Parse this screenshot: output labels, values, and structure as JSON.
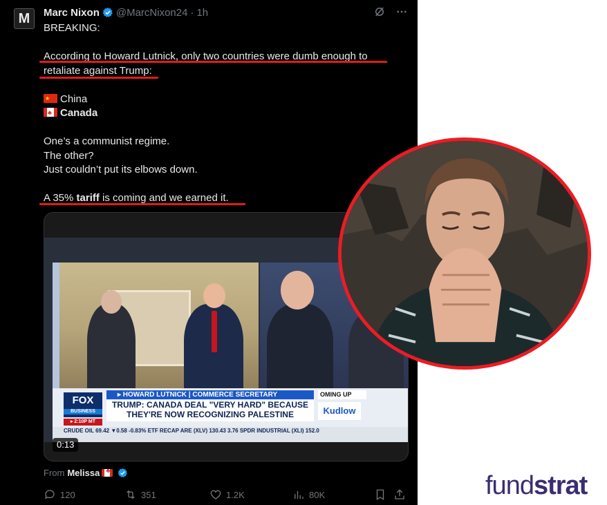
{
  "tweet": {
    "avatar_letter": "M",
    "display_name": "Marc Nixon",
    "handle": "@MarcNixon24",
    "separator": "·",
    "age": "1h",
    "lines": {
      "l1": "BREAKING:",
      "l2": "According to Howard Lutnick, only two countries were dumb enough to",
      "l3": "retaliate against Trump:",
      "l4": "China",
      "l5": "Canada",
      "l6": "One’s a communist regime.",
      "l7": "The other?",
      "l8": "Just couldn’t put its elbows down.",
      "l9_a": "A 35% ",
      "l9_b": "tariff",
      "l9_c": " is coming and we earned it."
    },
    "video": {
      "network_logo": "FOX",
      "network_sub": "BUSINESS",
      "time_badge": "▸ 2:10P MT",
      "name_bar": "▸ HOWARD LUTNICK | COMMERCE SECRETARY",
      "headline": "TRUMP: CANADA DEAL \"VERY HARD\" BECAUSE THEY'RE NOW RECOGNIZING PALESTINE",
      "coming_up": "OMING UP",
      "show": "Kudlow",
      "ticker": "CRUDE OIL 69.42 ▼0.58 -0.83%   ETF RECAP  ARE (XLV) 130.43  3.76   SPDR INDUSTRIAL (XLI) 152.0",
      "elapsed": "0:13"
    },
    "from_label": "From",
    "from_name": "Melissa",
    "stats": {
      "replies": "120",
      "reposts": "351",
      "likes": "1.2K",
      "views": "80K"
    }
  },
  "brand": {
    "part1": "fund",
    "part2": "strat"
  },
  "colors": {
    "background": "#000000",
    "text": "#e7e9ea",
    "muted": "#71767b",
    "verified": "#1d9bf0",
    "highlight_red": "#e41b1b",
    "brand_purple": "#3a2d73"
  },
  "icons": [
    "verified-badge-icon",
    "grok-icon",
    "more-icon",
    "reply-icon",
    "repost-icon",
    "like-icon",
    "views-icon",
    "bookmark-icon",
    "share-icon",
    "china-flag-icon",
    "canada-flag-icon"
  ]
}
